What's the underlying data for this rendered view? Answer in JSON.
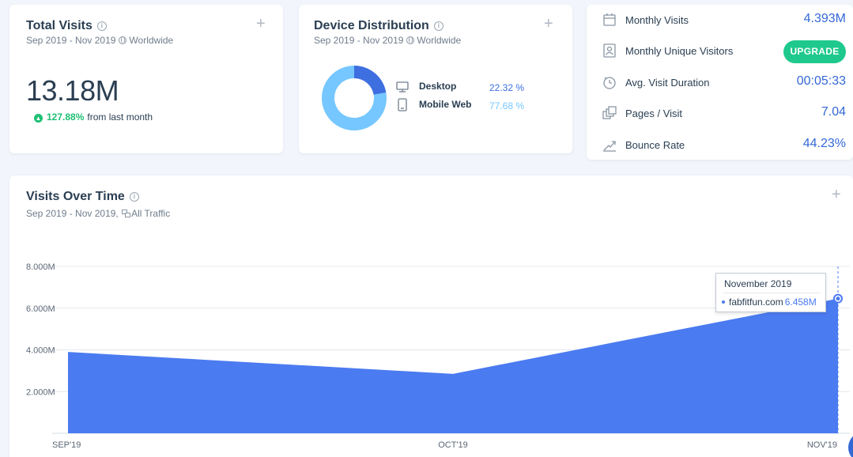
{
  "total_visits": {
    "title": "Total Visits",
    "date_range": "Sep 2019 - Nov 2019",
    "region": "Worldwide",
    "value": "13.18M",
    "change_pct": "127.88%",
    "change_text": "from last month"
  },
  "device_distribution": {
    "title": "Device Distribution",
    "date_range": "Sep 2019 - Nov 2019",
    "region": "Worldwide",
    "devices": [
      {
        "label": "Desktop",
        "value": "22.32 %",
        "fraction": 0.2232,
        "color": "#3e6fe0"
      },
      {
        "label": "Mobile Web",
        "value": "77.68 %",
        "fraction": 0.7768,
        "color": "#76c7ff"
      }
    ]
  },
  "metrics": [
    {
      "label": "Monthly Visits",
      "value": "4.393M",
      "icon": "calendar-icon"
    },
    {
      "label": "Monthly Unique Visitors",
      "value": "",
      "button": "UPGRADE",
      "icon": "visitor-icon"
    },
    {
      "label": "Avg. Visit Duration",
      "value": "00:05:33",
      "icon": "clock-icon"
    },
    {
      "label": "Pages / Visit",
      "value": "7.04",
      "icon": "pages-icon"
    },
    {
      "label": "Bounce Rate",
      "value": "44.23%",
      "icon": "bounce-icon"
    }
  ],
  "visits_over_time": {
    "title": "Visits Over Time",
    "date_range": "Sep 2019 - Nov 2019,",
    "traffic": "All Traffic",
    "tooltip": {
      "title": "November 2019",
      "site": "fabfitfun.com",
      "value": "6.458M"
    }
  },
  "chart_data": {
    "type": "area",
    "categories": [
      "SEP'19",
      "OCT'19",
      "NOV'19"
    ],
    "series": [
      {
        "values": [
          3.9,
          2.85,
          6.458
        ],
        "color": "#4b7bf0"
      }
    ],
    "y_ticks": [
      "2.000M",
      "4.000M",
      "6.000M",
      "8.000M"
    ],
    "y_tick_values": [
      2,
      4,
      6,
      8
    ],
    "ylim": [
      0,
      8
    ],
    "grid": true
  }
}
